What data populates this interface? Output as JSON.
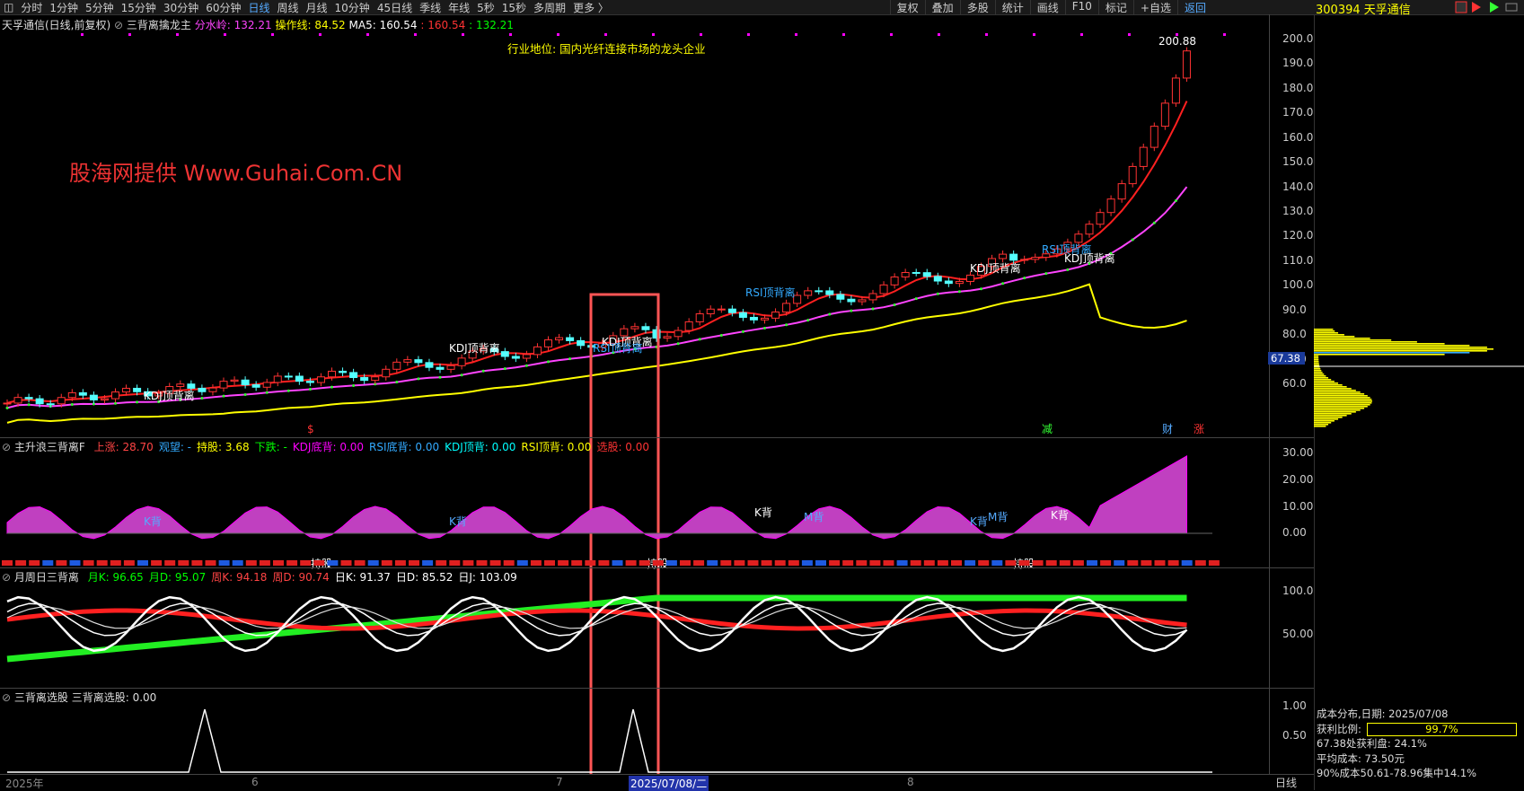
{
  "toolbar": {
    "timeframes": [
      "分时",
      "1分钟",
      "5分钟",
      "15分钟",
      "30分钟",
      "60分钟",
      "日线",
      "周线",
      "月线",
      "10分钟",
      "45日线",
      "季线",
      "年线",
      "5秒",
      "15秒",
      "多周期",
      "更多 〉"
    ],
    "active": "日线",
    "right_buttons": [
      "复权",
      "叠加",
      "多股",
      "统计",
      "画线",
      "F10",
      "标记",
      "+自选",
      "返回"
    ]
  },
  "stock": {
    "header": "300394 天孚通信"
  },
  "main_panel": {
    "title": "天孚通信(日线,前复权)",
    "indicator": "三背离擒龙主",
    "fenshui_label": "分水岭:",
    "fenshui_value": "132.21",
    "caozuo_label": "操作线:",
    "caozuo_value": "84.52",
    "ma5_label": "MA5:",
    "ma5_value": "160.54",
    "extra1": "160.54",
    "extra2": "132.21",
    "watermark": "股海网提供 Www.Guhai.Com.CN",
    "industry": "行业地位: 国内光纤连接市场的龙头企业",
    "high_label": "200.88",
    "y_ticks": [
      "200.0",
      "190.0",
      "180.0",
      "170.0",
      "160.0",
      "150.0",
      "140.0",
      "130.0",
      "120.0",
      "110.0",
      "100.0",
      "90.0",
      "80.0",
      "70.0",
      "60.0"
    ],
    "current_price": "67.38",
    "signals": [
      "KDJ顶背离",
      "KDJ顶背离",
      "RSI顶背离",
      "KDJ顶背离",
      "RSI顶背离",
      "KDJ顶背离",
      "RSI顶背离",
      "KDJ顶背离"
    ],
    "markers": [
      "$",
      "减",
      "财",
      "涨"
    ]
  },
  "panel2": {
    "title": "主升浪三背离F",
    "items": [
      {
        "label": "上涨:",
        "value": "28.70",
        "color": "#ff4444"
      },
      {
        "label": "观望:",
        "value": "-",
        "color": "#3af"
      },
      {
        "label": "持股:",
        "value": "3.68",
        "color": "#ff0"
      },
      {
        "label": "下跌:",
        "value": "-",
        "color": "#0f0"
      },
      {
        "label": "KDJ底背:",
        "value": "0.00",
        "color": "#f0f"
      },
      {
        "label": "RSI底背:",
        "value": "0.00",
        "color": "#3af"
      },
      {
        "label": "KDJ顶背:",
        "value": "0.00",
        "color": "#0ff"
      },
      {
        "label": "RSI顶背:",
        "value": "0.00",
        "color": "#ff0"
      },
      {
        "label": "选股:",
        "value": "0.00",
        "color": "#f33"
      }
    ],
    "y_ticks": [
      "30.00",
      "20.00",
      "10.00",
      "0.00"
    ],
    "labels": [
      "K背",
      "K背",
      "K背",
      "M背",
      "K背",
      "M背",
      "K背",
      "持股",
      "持股",
      "持股"
    ]
  },
  "panel3": {
    "title": "月周日三背离",
    "items": [
      {
        "label": "月K:",
        "value": "96.65",
        "color": "#0f0"
      },
      {
        "label": "月D:",
        "value": "95.07",
        "color": "#0f0"
      },
      {
        "label": "周K:",
        "value": "94.18",
        "color": "#f44"
      },
      {
        "label": "周D:",
        "value": "90.74",
        "color": "#f44"
      },
      {
        "label": "日K:",
        "value": "91.37",
        "color": "#fff"
      },
      {
        "label": "日D:",
        "value": "85.52",
        "color": "#fff"
      },
      {
        "label": "日J:",
        "value": "103.09",
        "color": "#fff"
      }
    ],
    "y_ticks": [
      "100.0",
      "50.00"
    ]
  },
  "panel4": {
    "title": "三背离选股",
    "item_label": "三背离选股:",
    "item_value": "0.00",
    "y_ticks": [
      "1.00",
      "0.50"
    ]
  },
  "date_axis": {
    "labels": [
      "2025年",
      "6",
      "7",
      "8"
    ],
    "highlight": "2025/07/08/二",
    "period": "日线"
  },
  "cost_info": {
    "line1": "成本分布,日期: 2025/07/08",
    "profit_label": "获利比例:",
    "profit_value": "99.7%",
    "line3": "67.38处获利盘: 24.1%",
    "line4": "平均成本: 73.50元",
    "line5": "90%成本50.61-78.96集中14.1%"
  },
  "colors": {
    "up": "#ff3333",
    "down": "#54ffff",
    "ma": "#ff2222",
    "fenshui": "#ff44ff",
    "yellow": "#ffff00"
  }
}
